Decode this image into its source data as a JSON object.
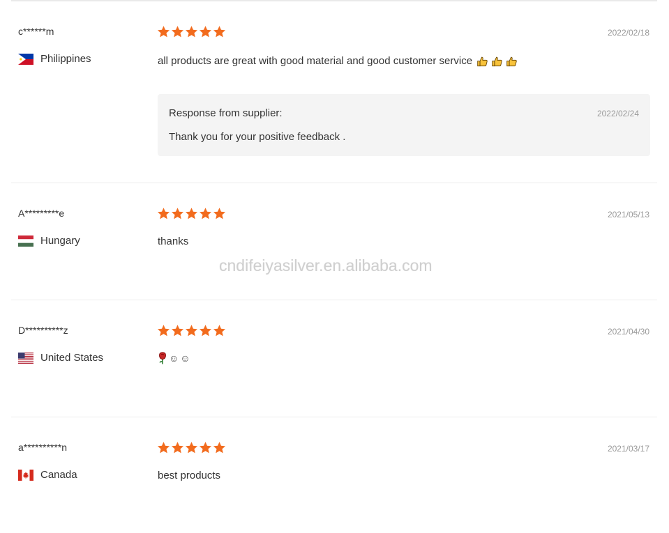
{
  "watermark": "cndifeiyasilver.en.alibaba.com",
  "colors": {
    "star": "#f26b1d",
    "date": "#999999",
    "response_bg": "#f4f4f4",
    "divider": "#ececec"
  },
  "reviews": [
    {
      "name": "c******m",
      "country": "Philippines",
      "flag": "philippines-flag-icon",
      "rating": 5,
      "date": "2022/02/18",
      "text": "all products are great with good material and good customer service",
      "emojis": [
        "thumbs-up-icon",
        "thumbs-up-icon",
        "thumbs-up-icon"
      ],
      "response": {
        "title": "Response from supplier:",
        "date": "2022/02/24",
        "text": "Thank you for your positive feedback ."
      }
    },
    {
      "name": "A*********e",
      "country": "Hungary",
      "flag": "hungary-flag-icon",
      "rating": 5,
      "date": "2021/05/13",
      "text": "thanks"
    },
    {
      "name": "D**********z",
      "country": "United States",
      "flag": "usa-flag-icon",
      "rating": 5,
      "date": "2021/04/30",
      "text": "",
      "emojis": [
        "rose-icon",
        "smile-icon",
        "smile-icon"
      ],
      "smile_glyph": "☺"
    },
    {
      "name": "a**********n",
      "country": "Canada",
      "flag": "canada-flag-icon",
      "rating": 5,
      "date": "2021/03/17",
      "text": "best products"
    }
  ]
}
